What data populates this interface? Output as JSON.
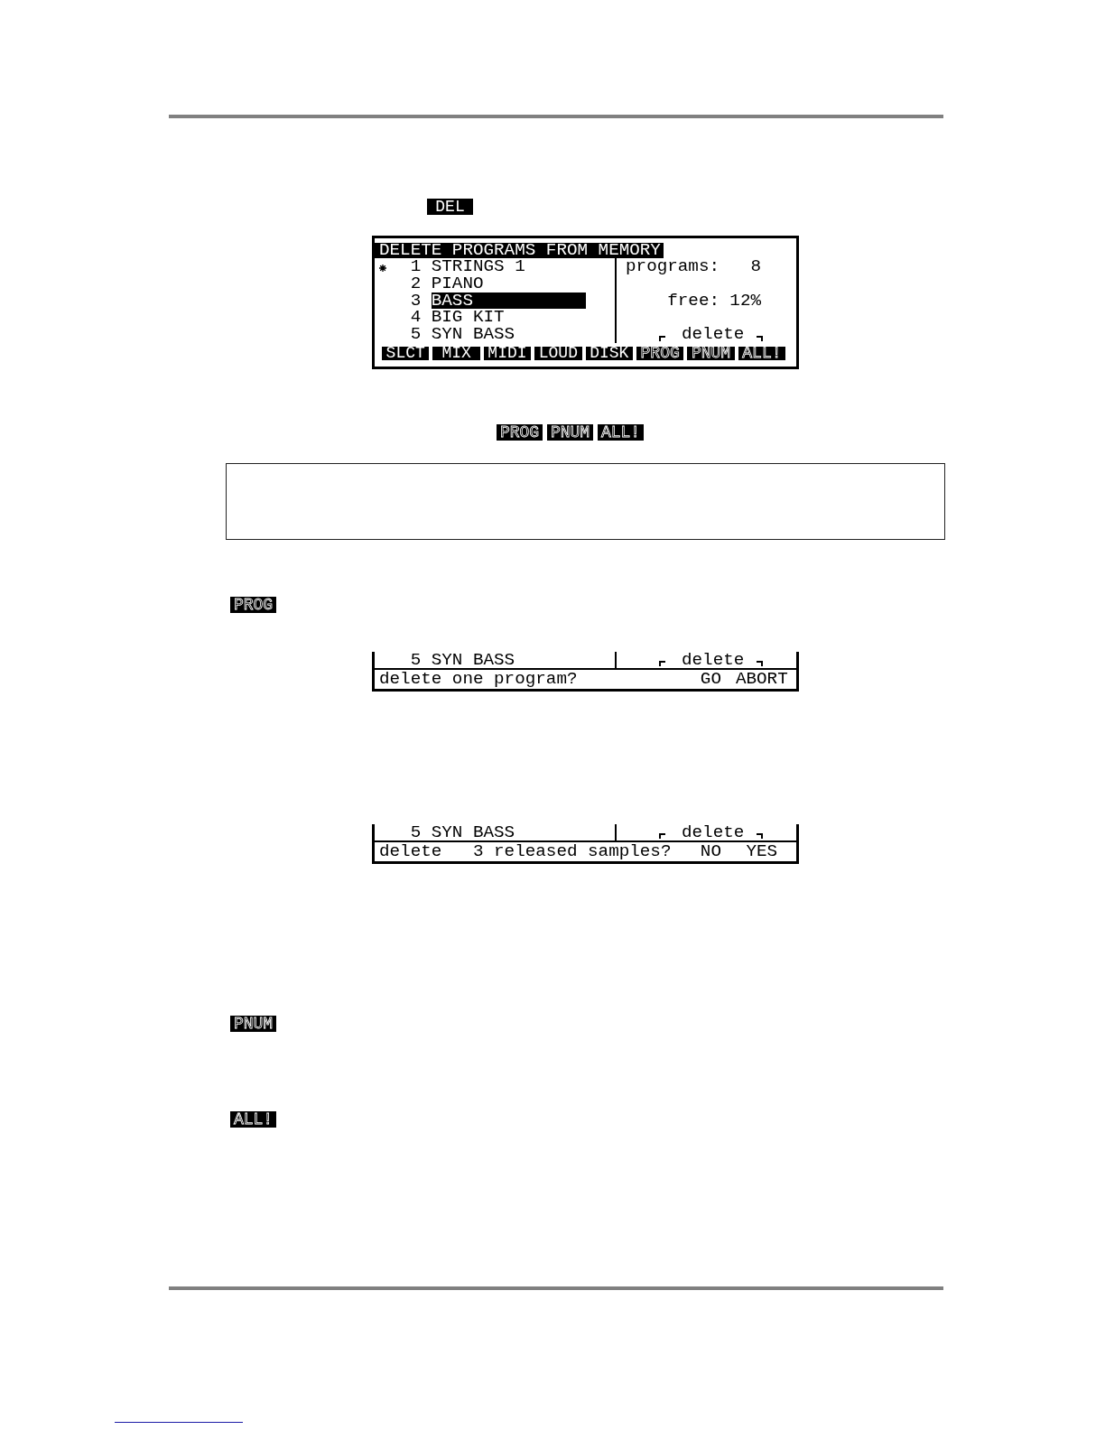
{
  "del_key": {
    "label": "DEL",
    "kind": "solid"
  },
  "delete_screen": {
    "title": "DELETE PROGRAMS FROM MEMORY",
    "programs": [
      {
        "current": true,
        "number": "1",
        "name": "STRINGS 1",
        "selected": false
      },
      {
        "current": false,
        "number": "2",
        "name": "PIANO",
        "selected": false
      },
      {
        "current": false,
        "number": "3",
        "name": "BASS",
        "selected": true
      },
      {
        "current": false,
        "number": "4",
        "name": "BIG KIT",
        "selected": false
      },
      {
        "current": false,
        "number": "5",
        "name": "SYN BASS",
        "selected": false
      }
    ],
    "stats": [
      {
        "label": "programs:",
        "value": "8"
      },
      {
        "label": "free:",
        "value": "12%"
      }
    ],
    "action": "delete",
    "soft_keys": [
      {
        "label": "SLCT",
        "kind": "solid"
      },
      {
        "label": "MIX",
        "kind": "solid"
      },
      {
        "label": "MIDI",
        "kind": "solid"
      },
      {
        "label": "LOUD",
        "kind": "solid"
      },
      {
        "label": "DISK",
        "kind": "solid"
      },
      {
        "label": "PROG",
        "kind": "outline"
      },
      {
        "label": "PNUM",
        "kind": "outline"
      },
      {
        "label": "ALL!",
        "kind": "outline"
      }
    ]
  },
  "function_keys": [
    {
      "label": "PROG",
      "kind": "outline"
    },
    {
      "label": "PNUM",
      "kind": "outline"
    },
    {
      "label": "ALL!",
      "kind": "outline"
    }
  ],
  "prog_key": {
    "label": "PROG",
    "kind": "outline"
  },
  "confirm_screen": {
    "program": {
      "number": "5",
      "name": "SYN BASS"
    },
    "action": "delete",
    "prompt": "delete one program?",
    "options": [
      "GO",
      "ABORT"
    ]
  },
  "release_screen": {
    "program": {
      "number": "5",
      "name": "SYN BASS"
    },
    "action": "delete",
    "prompt": "delete   3 released samples?",
    "options": [
      "NO",
      "YES"
    ]
  },
  "pnum_key": {
    "label": "PNUM",
    "kind": "outline"
  },
  "all_key": {
    "label": "ALL!",
    "kind": "outline"
  }
}
